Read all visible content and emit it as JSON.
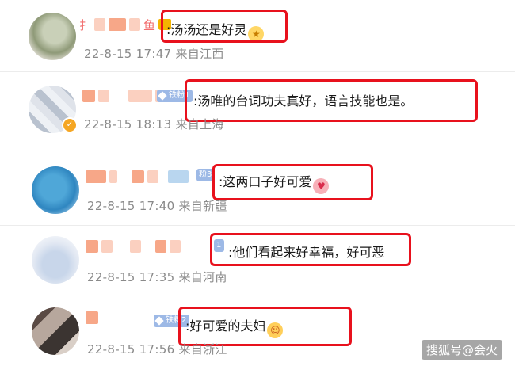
{
  "comments": [
    {
      "name_visible": "扌",
      "name_visible_2": "鱼",
      "text": ":汤汤还是好灵",
      "emoji": "star-emoji",
      "time": "22-8-15 17:47 来自江西"
    },
    {
      "badge": "铁粉1",
      "text": ":汤唯的台词功夫真好，语言技能也是。",
      "time": "22-8-15 18:13 来自上海"
    },
    {
      "badge": "粉3",
      "text": ":这两口子好可爱",
      "emoji": "heart-face-emoji",
      "time": "22-8-15 17:40 来自新疆"
    },
    {
      "badge": "1",
      "text": ":他们看起来好幸福，好可恶",
      "time": "22-8-15 17:35 来自河南"
    },
    {
      "badge": "铁粉2",
      "text": ":好可爱的夫妇",
      "emoji": "blush-face-emoji",
      "time": "22-8-15 17:56 来自浙江"
    }
  ],
  "watermark": "搜狐号@会火",
  "colors": {
    "highlight": "#e8111d",
    "meta_text": "#8a8a8a",
    "badge": "#9db9e6"
  }
}
